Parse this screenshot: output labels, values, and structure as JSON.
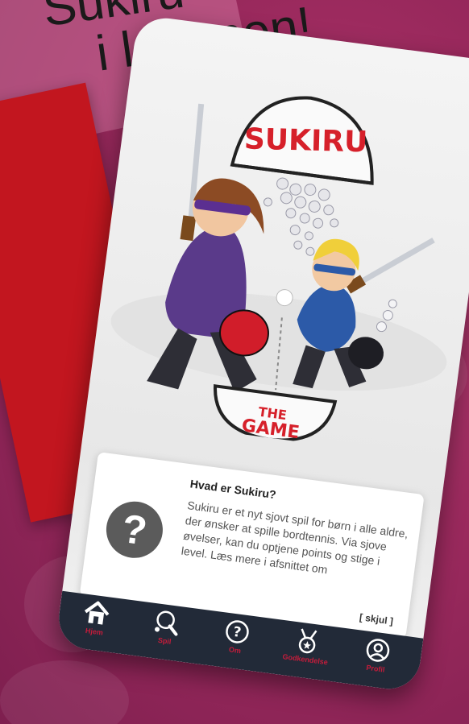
{
  "headline": {
    "line1": "Sukiru",
    "line2": "i lommen!"
  },
  "hero": {
    "logo_text": "SUKIRU",
    "bowl_text_line1": "THE",
    "bowl_text_line2": "GAME"
  },
  "info_card": {
    "icon": "question-circle-icon",
    "title": "Hvad er Sukiru?",
    "body": "Sukiru er et nyt sjovt spil for børn i alle aldre, der ønsker at spille bordtennis. Via sjove øvelser, kan du optjene points og stige i level. Læs mere i afsnittet om",
    "toggle": "[ skjul ]"
  },
  "tabs": [
    {
      "label": "Hjem",
      "icon": "home-icon",
      "active": true
    },
    {
      "label": "Spil",
      "icon": "ping-pong-icon"
    },
    {
      "label": "Om",
      "icon": "question-icon"
    },
    {
      "label": "Godkendelse",
      "icon": "medal-icon"
    },
    {
      "label": "Profil",
      "icon": "user-icon"
    }
  ],
  "colors": {
    "background": "#9c2a5e",
    "accent_red": "#c61c3b",
    "tabbar": "#222a38",
    "card": "#ffffff"
  }
}
